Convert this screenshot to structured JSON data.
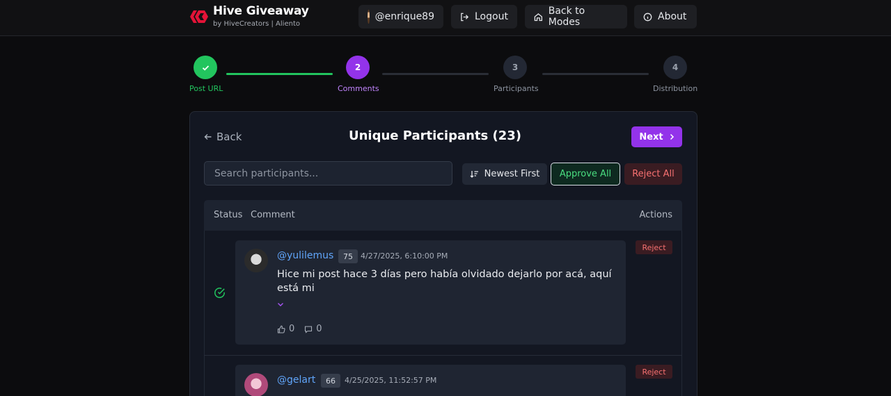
{
  "header": {
    "title": "Hive Giveaway",
    "subtitle": "by HiveCreators | Aliento",
    "user": "@enrique89",
    "logout": "Logout",
    "back_to_modes": "Back to Modes",
    "about": "About"
  },
  "stepper": {
    "steps": [
      {
        "number": "",
        "label": "Post URL",
        "state": "done"
      },
      {
        "number": "2",
        "label": "Comments",
        "state": "active"
      },
      {
        "number": "3",
        "label": "Participants",
        "state": "pending"
      },
      {
        "number": "4",
        "label": "Distribution",
        "state": "pending"
      }
    ]
  },
  "panel": {
    "back": "Back",
    "title": "Unique Participants (23)",
    "next": "Next",
    "search_placeholder": "Search participants...",
    "sort": "Newest First",
    "approve_all": "Approve All",
    "reject_all": "Reject All"
  },
  "table": {
    "headers": {
      "status": "Status",
      "comment": "Comment",
      "actions": "Actions"
    },
    "rows": [
      {
        "status": "approved",
        "user": "@yulilemus",
        "reputation": "75",
        "date": "4/27/2025, 6:10:00 PM",
        "text": "Hice mi post hace 3 días pero había olvidado dejarlo por acá, aquí está mi",
        "expand": "⌄",
        "likes": "0",
        "replies": "0",
        "action": "Reject"
      },
      {
        "status": "",
        "user": "@gelart",
        "reputation": "66",
        "date": "4/25/2025, 11:52:57 PM",
        "text": "",
        "action": "Reject"
      }
    ]
  },
  "colors": {
    "accent": "#9333ea",
    "success": "#22c55e",
    "danger": "#f87171",
    "link": "#60a5fa"
  }
}
